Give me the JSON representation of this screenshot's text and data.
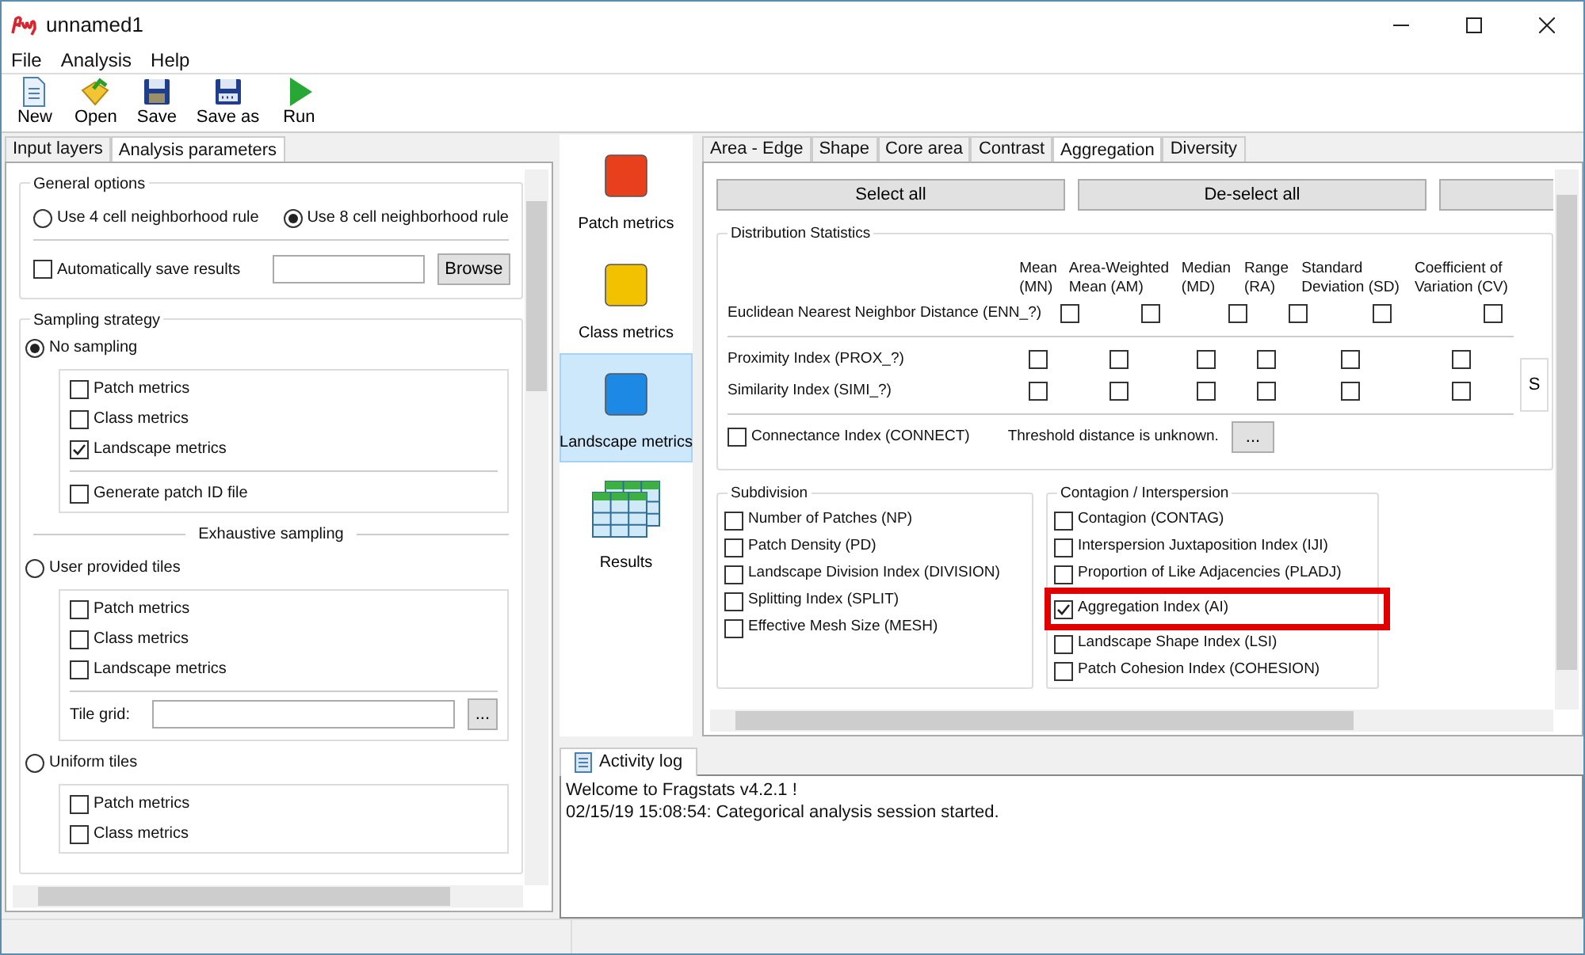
{
  "window": {
    "title": "unnamed1"
  },
  "menu": [
    "File",
    "Analysis",
    "Help"
  ],
  "toolbar": [
    {
      "label": "New",
      "kind": "new"
    },
    {
      "label": "Open",
      "kind": "open"
    },
    {
      "label": "Save",
      "kind": "save"
    },
    {
      "label": "Save as",
      "kind": "saveas"
    },
    {
      "label": "Run",
      "kind": "run"
    }
  ],
  "left_tabs": [
    {
      "label": "Input layers",
      "selected": false
    },
    {
      "label": "Analysis parameters",
      "selected": true
    }
  ],
  "general_options": {
    "title": "General options",
    "neighborhood": [
      {
        "label": "Use 4 cell neighborhood rule",
        "selected": false
      },
      {
        "label": "Use 8 cell neighborhood rule",
        "selected": true
      }
    ],
    "autosave": {
      "label": "Automatically save results",
      "checked": false
    },
    "browse": "Browse"
  },
  "sampling": {
    "title": "Sampling strategy",
    "sections": [
      {
        "kind": "strategy",
        "label": "No sampling",
        "selected": true,
        "options": [
          {
            "label": "Patch metrics",
            "checked": false
          },
          {
            "label": "Class metrics",
            "checked": false
          },
          {
            "label": "Landscape metrics",
            "checked": true
          }
        ],
        "extra": {
          "kind": "checkbox",
          "label": "Generate patch ID file",
          "checked": false
        }
      },
      {
        "kind": "divider",
        "label": "Exhaustive sampling"
      },
      {
        "kind": "strategy",
        "label": "User provided tiles",
        "selected": false,
        "options": [
          {
            "label": "Patch metrics",
            "checked": false
          },
          {
            "label": "Class metrics",
            "checked": false
          },
          {
            "label": "Landscape metrics",
            "checked": false
          }
        ],
        "extra": {
          "kind": "field",
          "label": "Tile grid:",
          "button": "..."
        }
      },
      {
        "kind": "strategy",
        "label": "Uniform tiles",
        "selected": false,
        "options": [
          {
            "label": "Patch metrics",
            "checked": false
          },
          {
            "label": "Class metrics",
            "checked": false
          }
        ]
      }
    ]
  },
  "categories": [
    {
      "label": "Patch metrics",
      "kind": "square",
      "color": "#e8401c",
      "selected": false
    },
    {
      "label": "Class metrics",
      "kind": "square",
      "color": "#f2c200",
      "selected": false
    },
    {
      "label": "Landscape metrics",
      "kind": "square",
      "color": "#1e88e5",
      "selected": true
    },
    {
      "label": "Results",
      "kind": "table",
      "selected": false
    }
  ],
  "metric_tabs": [
    {
      "label": "Area - Edge",
      "selected": false
    },
    {
      "label": "Shape",
      "selected": false
    },
    {
      "label": "Core area",
      "selected": false
    },
    {
      "label": "Contrast",
      "selected": false
    },
    {
      "label": "Aggregation",
      "selected": true
    },
    {
      "label": "Diversity",
      "selected": false
    }
  ],
  "buttons": [
    "Select all",
    "De-select all"
  ],
  "distribution": {
    "title": "Distribution Statistics",
    "columns": [
      {
        "lines": [
          "Mean",
          "(MN)"
        ]
      },
      {
        "lines": [
          "Area-Weighted",
          "Mean (AM)"
        ]
      },
      {
        "lines": [
          "Median",
          "(MD)"
        ]
      },
      {
        "lines": [
          "Range",
          "(RA)"
        ]
      },
      {
        "lines": [
          "Standard",
          "Deviation (SD)"
        ]
      },
      {
        "lines": [
          "Coefficient of",
          "Variation (CV)"
        ]
      }
    ],
    "rows": [
      {
        "label": "Euclidean Nearest Neighbor Distance  (ENN_?)",
        "checks": [
          false,
          false,
          false,
          false,
          false,
          false
        ]
      },
      {
        "label": "Proximity Index  (PROX_?)",
        "checks": [
          false,
          false,
          false,
          false,
          false,
          false
        ]
      },
      {
        "label": "Similarity Index  (SIMI_?)",
        "checks": [
          false,
          false,
          false,
          false,
          false,
          false
        ]
      }
    ],
    "side_button": "S",
    "connectance": {
      "label": "Connectance Index  (CONNECT)",
      "checked": false,
      "note": "Threshold distance is unknown.",
      "button": "..."
    }
  },
  "subdivision": {
    "title": "Subdivision",
    "items": [
      {
        "label": "Number of Patches  (NP)",
        "checked": false
      },
      {
        "label": "Patch Density  (PD)",
        "checked": false
      },
      {
        "label": "Landscape Division Index  (DIVISION)",
        "checked": false
      },
      {
        "label": "Splitting Index  (SPLIT)",
        "checked": false
      },
      {
        "label": "Effective Mesh Size  (MESH)",
        "checked": false
      }
    ]
  },
  "contagion": {
    "title": "Contagion / Interspersion",
    "items": [
      {
        "label": "Contagion  (CONTAG)",
        "checked": false,
        "highlighted": false
      },
      {
        "label": "Interspersion  Juxtaposition Index (IJI)",
        "checked": false,
        "highlighted": false
      },
      {
        "label": "Proportion of Like Adjacencies  (PLADJ)",
        "checked": false,
        "highlighted": false
      },
      {
        "label": "Aggregation Index  (AI)",
        "checked": true,
        "highlighted": true
      },
      {
        "label": "Landscape Shape Index  (LSI)",
        "checked": false,
        "highlighted": false
      },
      {
        "label": "Patch Cohesion Index  (COHESION)",
        "checked": false,
        "highlighted": false
      }
    ]
  },
  "activity_log": {
    "tab": "Activity log",
    "lines": [
      "Welcome to Fragstats v4.2.1 !",
      "02/15/19 15:08:54: Categorical analysis session started."
    ]
  }
}
